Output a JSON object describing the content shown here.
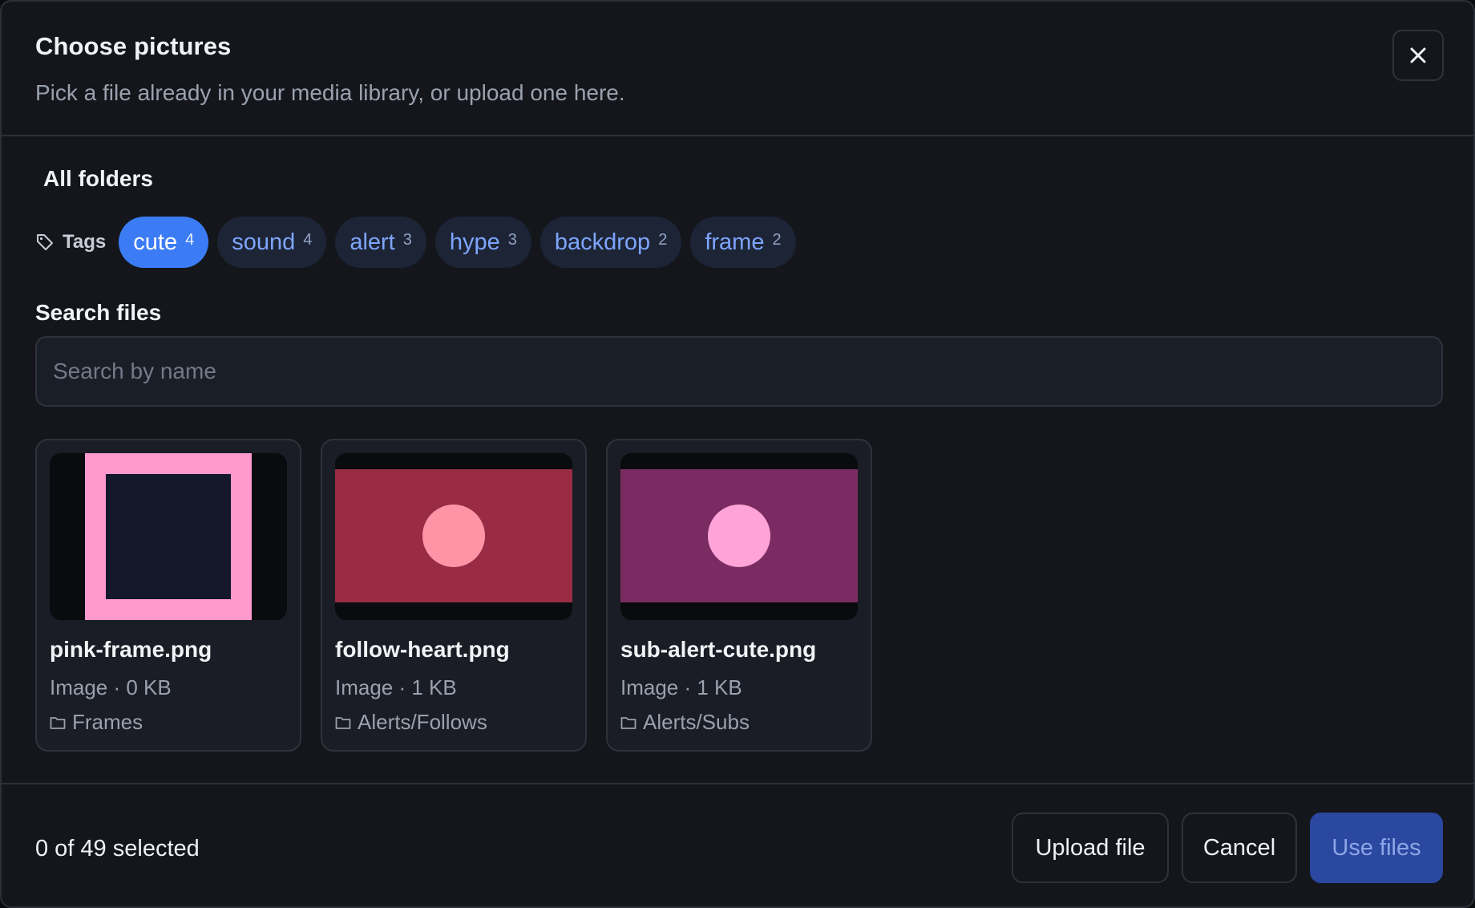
{
  "dialog": {
    "title": "Choose pictures",
    "subtitle": "Pick a file already in your media library, or upload one here.",
    "close_icon": "close-icon"
  },
  "folders": {
    "title": "All folders"
  },
  "tags": {
    "label": "Tags",
    "icon": "tag-icon",
    "items": [
      {
        "name": "cute",
        "count": "4",
        "active": true
      },
      {
        "name": "sound",
        "count": "4",
        "active": false
      },
      {
        "name": "alert",
        "count": "3",
        "active": false
      },
      {
        "name": "hype",
        "count": "3",
        "active": false
      },
      {
        "name": "backdrop",
        "count": "2",
        "active": false
      },
      {
        "name": "frame",
        "count": "2",
        "active": false
      }
    ]
  },
  "search": {
    "label": "Search files",
    "placeholder": "Search by name",
    "value": ""
  },
  "files": [
    {
      "name": "pink-frame.png",
      "meta": "Image · 0 KB",
      "folder": "Frames",
      "folder_icon": "folder-icon"
    },
    {
      "name": "follow-heart.png",
      "meta": "Image · 1 KB",
      "folder": "Alerts/Follows",
      "folder_icon": "folder-icon"
    },
    {
      "name": "sub-alert-cute.png",
      "meta": "Image · 1 KB",
      "folder": "Alerts/Subs",
      "folder_icon": "folder-icon"
    }
  ],
  "footer": {
    "selected_text": "0 of 49 selected",
    "upload_label": "Upload file",
    "cancel_label": "Cancel",
    "use_label": "Use files"
  },
  "colors": {
    "accent": "#3b7cf5",
    "primary_disabled": "#2a48a0",
    "background": "#14161c",
    "pink_frame": "#ff99cc",
    "follow_bg": "#992b45",
    "follow_dot": "#ff94a6",
    "sub_bg": "#7a2c62",
    "sub_dot": "#ffa3d8"
  }
}
